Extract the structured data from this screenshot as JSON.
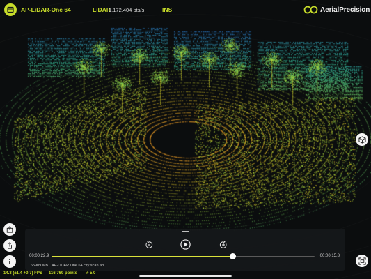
{
  "header": {
    "device_name": "AP-LiDAR-One 64",
    "lidar_label": "LiDAR",
    "lidar_rate": "1.172.404 pts/s",
    "ins_label": "INS",
    "brand_name": "AerialPrecision",
    "accent_color": "#c7dc2a"
  },
  "icons": {
    "device": "lidar-device-icon",
    "brand": "aerialprecision-logo",
    "view_cube": "cube-icon",
    "capture": "screenshot-icon",
    "export": "export-icon",
    "share": "share-icon",
    "info": "info-icon",
    "rewind": "rewind-icon",
    "play": "play-icon",
    "forward": "forward-icon"
  },
  "playback": {
    "current_time": "00:00:22.9",
    "end_time": "00:00:15.8",
    "progress_fraction": 0.69,
    "file_size": "65909 MB",
    "file_name": "AP-LiDAR One 64 city scan.ap"
  },
  "status": {
    "fps": "14.3 (±1.4 +0.7) FPS",
    "points": "116.769 points",
    "frame": "# 5.0"
  }
}
